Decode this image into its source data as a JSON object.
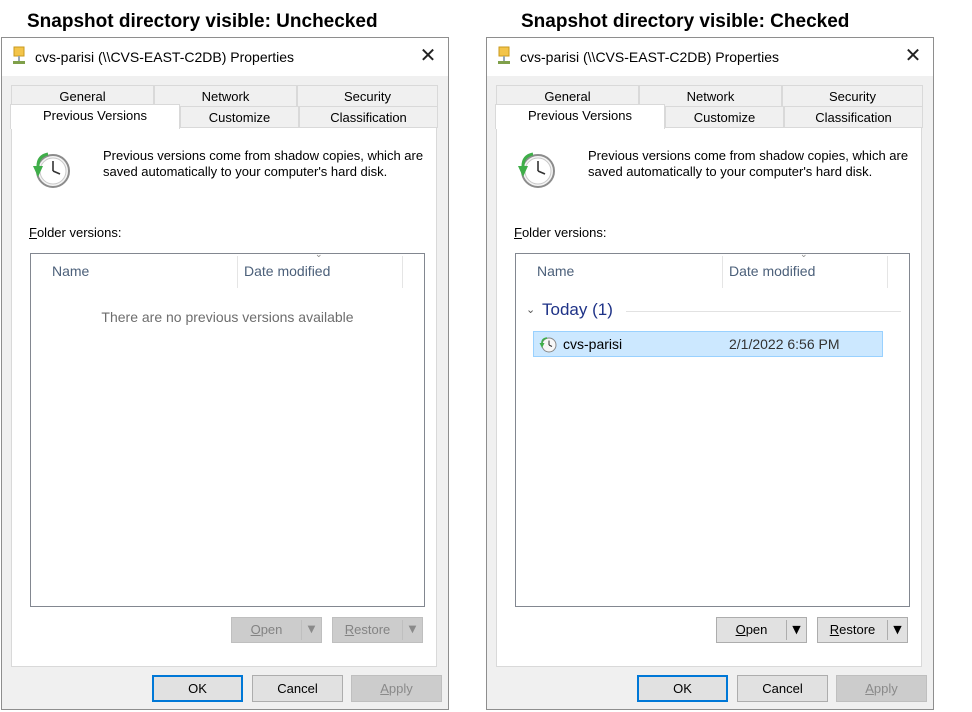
{
  "captions": {
    "left": "Snapshot directory visible: Unchecked",
    "right": "Snapshot directory visible: Checked"
  },
  "dialog": {
    "title": "cvs-parisi (\\\\CVS-EAST-C2DB) Properties",
    "close_label": "✕",
    "tabs_row1": [
      "General",
      "Network",
      "Security"
    ],
    "tabs_row2": [
      "Previous Versions",
      "Customize",
      "Classification"
    ],
    "active_tab": "Previous Versions",
    "info_text": "Previous versions come from shadow copies, which are saved automatically to your computer's hard disk.",
    "folder_versions_label_prefix": "F",
    "folder_versions_label_rest": "older versions:",
    "columns": [
      "Name",
      "Date modified"
    ],
    "open_prefix": "O",
    "open_rest": "pen",
    "restore_prefix": "R",
    "restore_rest": "estore",
    "ok_label": "OK",
    "cancel_label": "Cancel",
    "apply_prefix": "A",
    "apply_rest": "pply",
    "dropdown_glyph": "▼"
  },
  "left": {
    "empty_message": "There are no previous versions available",
    "open_enabled": false,
    "restore_enabled": false
  },
  "right": {
    "group_chevron": "⌄",
    "group_label": "Today (1)",
    "items": [
      {
        "name": "cvs-parisi",
        "date_modified": "2/1/2022 6:56 PM",
        "selected": true
      }
    ],
    "open_enabled": true,
    "restore_enabled": true
  },
  "colors": {
    "selection": "#cce8ff",
    "group_header": "#1e3287",
    "default_button_border": "#0078d7"
  }
}
